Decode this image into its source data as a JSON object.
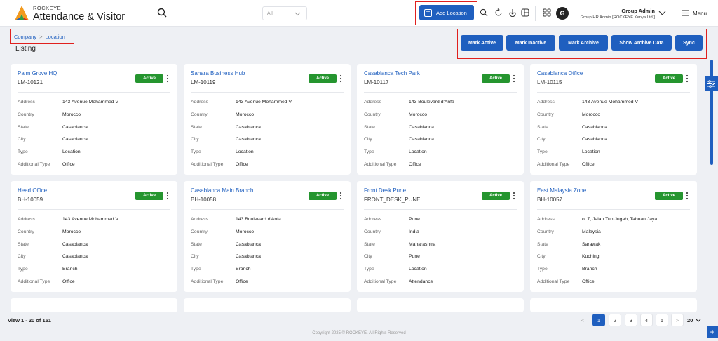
{
  "header": {
    "brand_small": "ROCKEYE",
    "brand_title": "Attendance & Visitor",
    "search_placeholder": "",
    "filter_value": "All",
    "add_location_label": "Add Location",
    "user_name": "Group Admin",
    "user_role": "Group HR Admin [ROCKEYE Kenya Ltd.]",
    "avatar_initial": "G",
    "menu_label": "Menu"
  },
  "breadcrumb": {
    "company": "Company",
    "separator": ">",
    "location": "Location"
  },
  "page_title": "Listing",
  "actions": {
    "mark_active": "Mark Active",
    "mark_inactive": "Mark Inactive",
    "mark_archive": "Mark Archive",
    "show_archive": "Show Archive Data",
    "sync": "Sync"
  },
  "field_labels": {
    "address": "Address",
    "country": "Country",
    "state": "State",
    "city": "City",
    "type": "Type",
    "additional_type": "Additional Type"
  },
  "cards": [
    {
      "name": "Palm Grove HQ",
      "code": "LM-10121",
      "status": "Active",
      "address": "143 Avenue Mohammed V",
      "country": "Morocco",
      "state": "Casablanca",
      "city": "Casablanca",
      "type": "Location",
      "additional_type": "Office"
    },
    {
      "name": "Sahara Business Hub",
      "code": "LM-10119",
      "status": "Active",
      "address": "143 Avenue Mohammed V",
      "country": "Morocco",
      "state": "Casablanca",
      "city": "Casablanca",
      "type": "Location",
      "additional_type": "Office"
    },
    {
      "name": "Casablanca Tech Park",
      "code": "LM-10117",
      "status": "Active",
      "address": "143 Boulevard d'Anfa",
      "country": "Morocco",
      "state": "Casablanca",
      "city": "Casablanca",
      "type": "Location",
      "additional_type": "Office"
    },
    {
      "name": "Casablanca Office",
      "code": "LM-10115",
      "status": "Active",
      "address": "143 Avenue Mohammed V",
      "country": "Morocco",
      "state": "Casablanca",
      "city": "Casablanca",
      "type": "Location",
      "additional_type": "Office"
    },
    {
      "name": "Head Office",
      "code": "BH-10059",
      "status": "Active",
      "address": "143 Avenue Mohammed V",
      "country": "Morocco",
      "state": "Casablanca",
      "city": "Casablanca",
      "type": "Branch",
      "additional_type": "Office"
    },
    {
      "name": "Casablanca Main Branch",
      "code": "BH-10058",
      "status": "Active",
      "address": "143 Boulevard d'Anfa",
      "country": "Morocco",
      "state": "Casablanca",
      "city": "Casablanca",
      "type": "Branch",
      "additional_type": "Office"
    },
    {
      "name": "Front Desk Pune",
      "code": "FRONT_DESK_PUNE",
      "status": "Active",
      "address": "Pune",
      "country": "India",
      "state": "Maharashtra",
      "city": "Pune",
      "type": "Location",
      "additional_type": "Attendance"
    },
    {
      "name": "East Malaysia Zone",
      "code": "BH-10057",
      "status": "Active",
      "address": "ot 7, Jalan Tun Jugah, Tabuan Jaya",
      "country": "Malaysia",
      "state": "Sarawak",
      "city": "Kuching",
      "type": "Branch",
      "additional_type": "Office"
    }
  ],
  "footer": {
    "view_count": "View 1 - 20 of 151",
    "pages": [
      "1",
      "2",
      "3",
      "4",
      "5"
    ],
    "prev": "<",
    "next": ">",
    "per_page": "20",
    "copyright": "Copyright 2025 © ROCKEYE. All Rights Reserved",
    "fab_label": "+"
  },
  "colors": {
    "primary": "#1f5fbf",
    "active_green": "#25952f",
    "highlight_red": "#e0201e"
  }
}
